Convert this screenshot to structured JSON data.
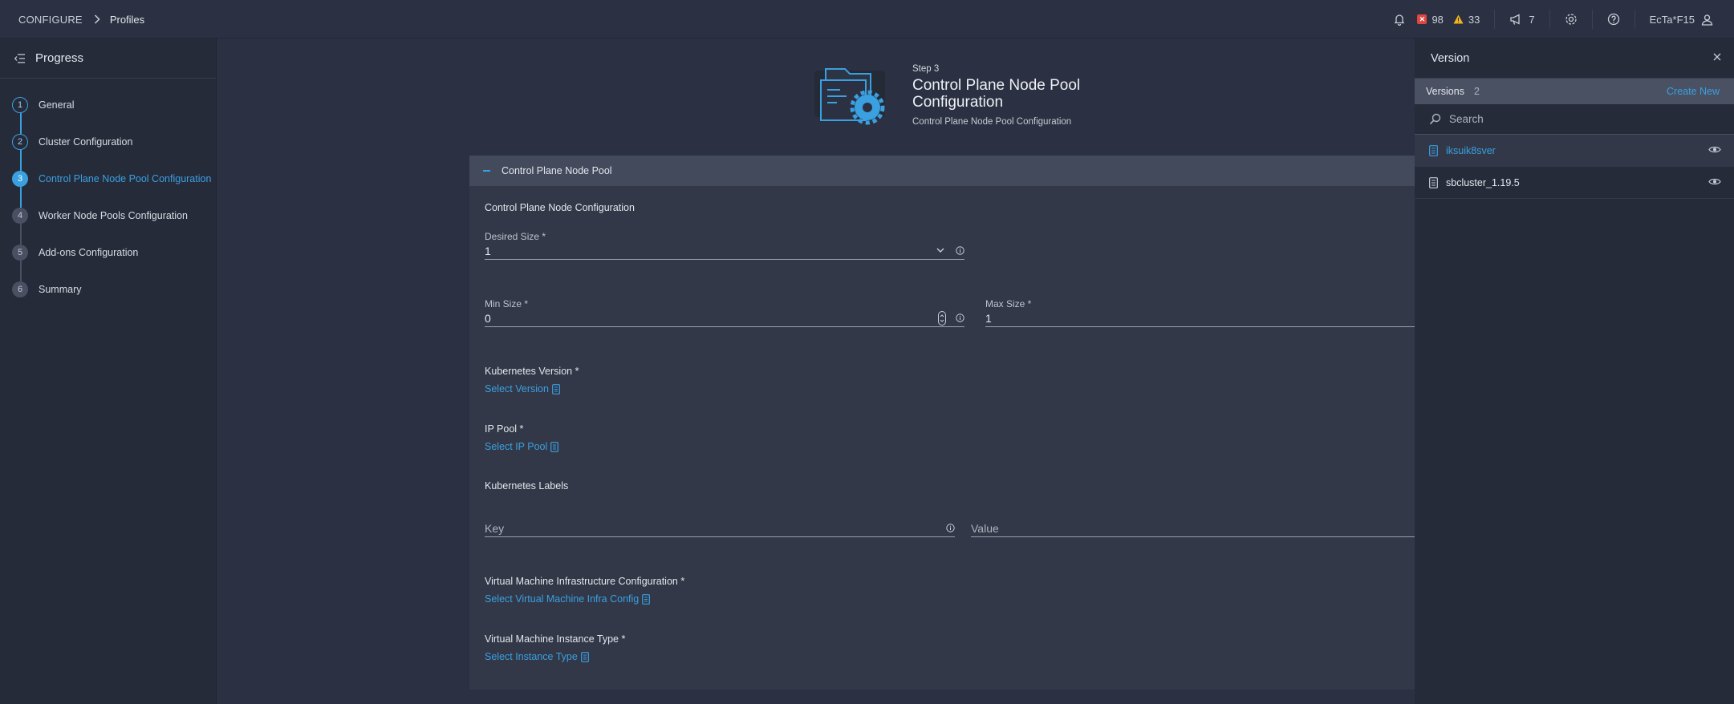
{
  "breadcrumb": {
    "section": "CONFIGURE",
    "page": "Profiles"
  },
  "topbar": {
    "alerts_critical": "98",
    "alerts_warning": "33",
    "announcements": "7",
    "user": "EcTa*F15"
  },
  "progress": {
    "title": "Progress",
    "steps": [
      {
        "num": "1",
        "label": "General",
        "state": "done"
      },
      {
        "num": "2",
        "label": "Cluster Configuration",
        "state": "done"
      },
      {
        "num": "3",
        "label": "Control Plane Node Pool Configuration",
        "state": "active"
      },
      {
        "num": "4",
        "label": "Worker Node Pools Configuration",
        "state": "todo"
      },
      {
        "num": "5",
        "label": "Add-ons Configuration",
        "state": "todo"
      },
      {
        "num": "6",
        "label": "Summary",
        "state": "todo"
      }
    ]
  },
  "step_header": {
    "step": "Step 3",
    "title": "Control Plane Node Pool Configuration",
    "subtitle": "Control Plane Node Pool Configuration"
  },
  "form": {
    "section_label": "Control Plane Node Pool",
    "node_config_title": "Control Plane Node Configuration",
    "desired_size": {
      "label": "Desired Size *",
      "value": "1"
    },
    "min_size": {
      "label": "Min Size *",
      "value": "0"
    },
    "max_size": {
      "label": "Max Size *",
      "value": "1"
    },
    "k8s_version": {
      "label": "Kubernetes Version *",
      "link": "Select Version"
    },
    "ip_pool": {
      "label": "IP Pool *",
      "link": "Select IP Pool"
    },
    "k8s_labels": {
      "label": "Kubernetes Labels",
      "key_placeholder": "Key",
      "value_placeholder": "Value"
    },
    "vm_infra": {
      "label": "Virtual Machine Infrastructure Configuration *",
      "link": "Select Virtual Machine Infra Config"
    },
    "vm_instance": {
      "label": "Virtual Machine Instance Type *",
      "link": "Select Instance Type"
    }
  },
  "version_panel": {
    "title": "Version",
    "versions_label": "Versions",
    "versions_count": "2",
    "create_new": "Create New",
    "search_placeholder": "Search",
    "items": [
      {
        "name": "iksuik8sver",
        "selected": true
      },
      {
        "name": "sbcluster_1.19.5",
        "selected": false
      }
    ]
  },
  "colors": {
    "accent": "#3aa0e0",
    "critical": "#e0453e",
    "warning": "#f2b31b"
  }
}
